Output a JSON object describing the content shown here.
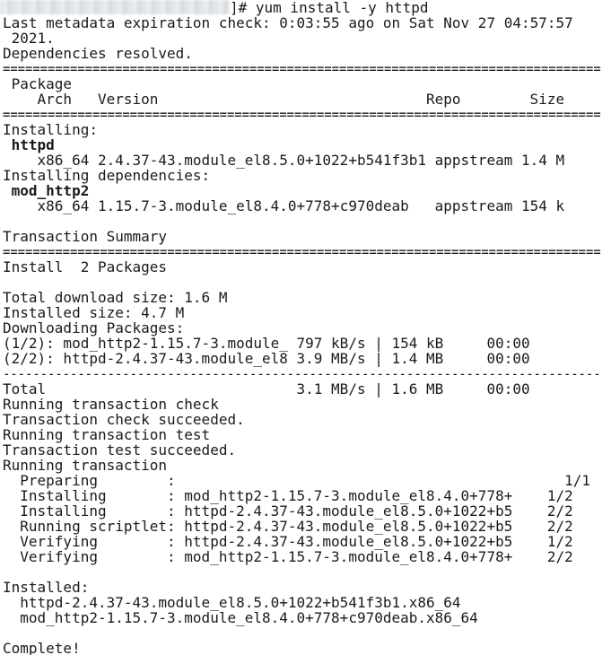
{
  "terminal": {
    "prompt_suffix": "]# yum install -y httpd",
    "lines": [
      {
        "text": "Last metadata expiration check: 0:03:55 ago on Sat Nov 27 04:57:57",
        "bold": false
      },
      {
        "text": " 2021.",
        "bold": false
      },
      {
        "text": "Dependencies resolved.",
        "bold": false
      },
      {
        "text": "================================================================================",
        "bold": false
      },
      {
        "text": " Package",
        "bold": false
      },
      {
        "text": "    Arch   Version                               Repo        Size",
        "bold": false
      },
      {
        "text": "================================================================================",
        "bold": false
      },
      {
        "text": "Installing:",
        "bold": false
      },
      {
        "text": " httpd",
        "bold": true
      },
      {
        "text": "    x86_64 2.4.37-43.module_el8.5.0+1022+b541f3b1 appstream 1.4 M",
        "bold": false
      },
      {
        "text": "Installing dependencies:",
        "bold": false
      },
      {
        "text": " mod_http2",
        "bold": true
      },
      {
        "text": "    x86_64 1.15.7-3.module_el8.4.0+778+c970deab   appstream 154 k",
        "bold": false
      },
      {
        "text": "",
        "bold": false
      },
      {
        "text": "Transaction Summary",
        "bold": false
      },
      {
        "text": "================================================================================",
        "bold": false
      },
      {
        "text": "Install  2 Packages",
        "bold": false
      },
      {
        "text": "",
        "bold": false
      },
      {
        "text": "Total download size: 1.6 M",
        "bold": false
      },
      {
        "text": "Installed size: 4.7 M",
        "bold": false
      },
      {
        "text": "Downloading Packages:",
        "bold": false
      },
      {
        "text": "(1/2): mod_http2-1.15.7-3.module_ 797 kB/s | 154 kB     00:00",
        "bold": false
      },
      {
        "text": "(2/2): httpd-2.4.37-43.module_el8 3.9 MB/s | 1.4 MB     00:00",
        "bold": false
      },
      {
        "text": "--------------------------------------------------------------------------------",
        "bold": false
      },
      {
        "text": "Total                             3.1 MB/s | 1.6 MB     00:00",
        "bold": false
      },
      {
        "text": "Running transaction check",
        "bold": false
      },
      {
        "text": "Transaction check succeeded.",
        "bold": false
      },
      {
        "text": "Running transaction test",
        "bold": false
      },
      {
        "text": "Transaction test succeeded.",
        "bold": false
      },
      {
        "text": "Running transaction",
        "bold": false
      },
      {
        "text": "  Preparing        :                                             1/1",
        "bold": false
      },
      {
        "text": "  Installing       : mod_http2-1.15.7-3.module_el8.4.0+778+    1/2",
        "bold": false
      },
      {
        "text": "  Installing       : httpd-2.4.37-43.module_el8.5.0+1022+b5    2/2",
        "bold": false
      },
      {
        "text": "  Running scriptlet: httpd-2.4.37-43.module_el8.5.0+1022+b5    2/2",
        "bold": false
      },
      {
        "text": "  Verifying        : httpd-2.4.37-43.module_el8.5.0+1022+b5    1/2",
        "bold": false
      },
      {
        "text": "  Verifying        : mod_http2-1.15.7-3.module_el8.4.0+778+    2/2",
        "bold": false
      },
      {
        "text": "",
        "bold": false
      },
      {
        "text": "Installed:",
        "bold": false
      },
      {
        "text": "  httpd-2.4.37-43.module_el8.5.0+1022+b541f3b1.x86_64",
        "bold": false
      },
      {
        "text": "  mod_http2-1.15.7-3.module_el8.4.0+778+c970deab.x86_64",
        "bold": false
      },
      {
        "text": "",
        "bold": false
      },
      {
        "text": "Complete!",
        "bold": false
      }
    ]
  }
}
